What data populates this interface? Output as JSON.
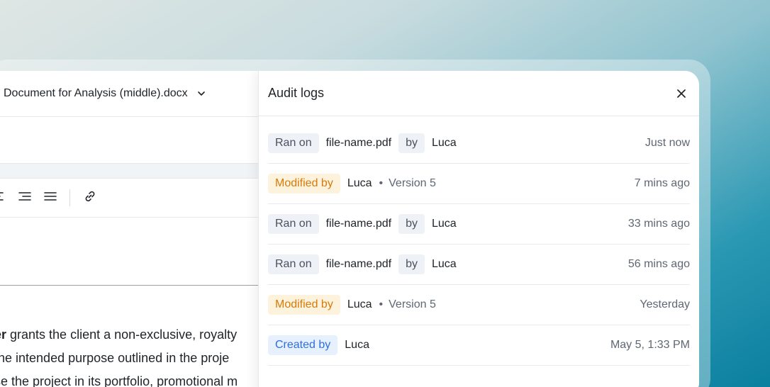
{
  "document": {
    "title": "Document for Analysis (middle).docx",
    "body": [
      {
        "bold": "er",
        "text": " grants the client a non-exclusive, royalty"
      },
      {
        "bold": "",
        "text": " the intended purpose outlined in the proje"
      },
      {
        "bold": "",
        "text": "se the project in its portfolio, promotional m"
      }
    ]
  },
  "panel": {
    "title": "Audit logs",
    "rows": [
      {
        "type": "ran",
        "chip": "Ran on",
        "file": "file-name.pdf",
        "by_chip": "by",
        "user": "Luca",
        "time": "Just now"
      },
      {
        "type": "modified",
        "chip": "Modified by",
        "user": "Luca",
        "sep": "•",
        "version": "Version 5",
        "time": "7 mins ago"
      },
      {
        "type": "ran",
        "chip": "Ran on",
        "file": "file-name.pdf",
        "by_chip": "by",
        "user": "Luca",
        "time": "33 mins ago"
      },
      {
        "type": "ran",
        "chip": "Ran on",
        "file": "file-name.pdf",
        "by_chip": "by",
        "user": "Luca",
        "time": "56 mins ago"
      },
      {
        "type": "modified",
        "chip": "Modified by",
        "user": "Luca",
        "sep": "•",
        "version": "Version 5",
        "time": "Yesterday"
      },
      {
        "type": "created",
        "chip": "Created by",
        "user": "Luca",
        "time": "May 5, 1:33 PM"
      }
    ]
  },
  "colors": {
    "modified_chip_text": "#d77a0a",
    "modified_chip_bg": "#fdf3dc",
    "created_chip_text": "#2f6fe0",
    "created_chip_bg": "#e7f0fd",
    "neutral_chip_bg": "#eef1f5"
  },
  "icons": {
    "doc_title_dropdown": "chevron-down-icon",
    "close": "close-icon",
    "toolbar": [
      "align-left-icon",
      "align-right-icon",
      "align-justify-icon",
      "link-icon"
    ]
  }
}
